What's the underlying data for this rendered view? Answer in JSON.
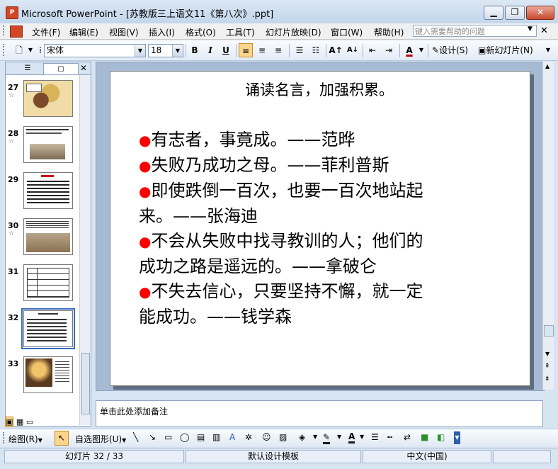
{
  "window": {
    "title": "Microsoft PowerPoint - [苏教版三上语文11《第八次》.ppt]",
    "app_icon_text": "P"
  },
  "menu": {
    "items": [
      "文件(F)",
      "编辑(E)",
      "视图(V)",
      "插入(I)",
      "格式(O)",
      "工具(T)",
      "幻灯片放映(D)",
      "窗口(W)",
      "帮助(H)"
    ],
    "help_placeholder": "键入需要帮助的问题"
  },
  "toolbar": {
    "font_name": "宋体",
    "font_size": "18",
    "bold": "B",
    "italic": "I",
    "underline": "U",
    "design_label": "设计(S)",
    "new_slide_label": "新幻灯片(N)"
  },
  "slides_pane": {
    "slides": [
      {
        "number": "27",
        "has_star": true
      },
      {
        "number": "28",
        "has_star": true
      },
      {
        "number": "29",
        "has_star": false
      },
      {
        "number": "30",
        "has_star": true
      },
      {
        "number": "31",
        "has_star": false
      },
      {
        "number": "32",
        "has_star": false,
        "selected": true
      },
      {
        "number": "33",
        "has_star": false
      }
    ]
  },
  "slide": {
    "title": "诵读名言，加强积累。",
    "bullets": [
      {
        "lines": [
          "有志者，事竟成。——范晔"
        ]
      },
      {
        "lines": [
          "失败乃成功之母。——菲利普斯"
        ]
      },
      {
        "lines": [
          "即使跌倒一百次，也要一百次地站起",
          "来。——张海迪"
        ]
      },
      {
        "lines": [
          "不会从失败中找寻教训的人；他们的",
          "成功之路是遥远的。——拿破仑"
        ]
      },
      {
        "lines": [
          "不失去信心，只要坚持不懈，就一定",
          "能成功。——钱学森"
        ]
      }
    ]
  },
  "notes": {
    "placeholder": "单击此处添加备注"
  },
  "drawing_toolbar": {
    "draw_label": "绘图(R)",
    "autoshapes_label": "自选图形(U)"
  },
  "statusbar": {
    "slide_info": "幻灯片 32 / 33",
    "template": "默认设计模板",
    "language": "中文(中国)"
  },
  "colors": {
    "bullet": "#ff0000",
    "selection_outline": "#3e6bbd",
    "workspace_bg": "#a7bad3"
  }
}
